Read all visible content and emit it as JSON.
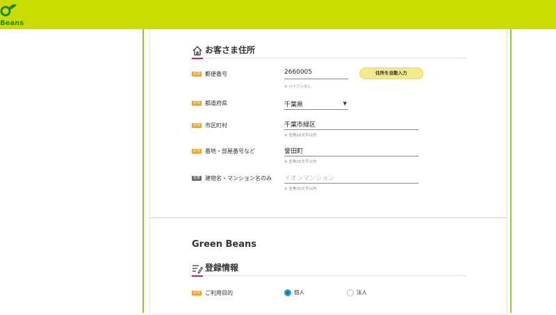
{
  "header": {
    "logo_text": "Beans",
    "brand_color": "#c8dc00"
  },
  "address_section": {
    "title": "お客さま住所",
    "icon": "house-icon",
    "required_badge": "必須",
    "optional_badge": "任意",
    "postal": {
      "label": "郵便番号",
      "value": "2660005",
      "note": "※ ハイフンなし",
      "autofill_button": "住所を自動入力"
    },
    "prefecture": {
      "label": "都道府県",
      "value": "千葉県"
    },
    "city": {
      "label": "市区町村",
      "value": "千葉市緑区",
      "note": "※ 全角20文字以内"
    },
    "street": {
      "label": "番地・部屋番号など",
      "value": "誉田町",
      "note": "※ 全角20文字以内"
    },
    "building": {
      "label": "建物名・マンション名のみ",
      "placeholder": "イオンマンション",
      "note": "※ 全角30文字以内"
    }
  },
  "registration_section": {
    "brand_title": "Green Beans",
    "title": "登録情報",
    "icon": "edit-list-icon",
    "purpose": {
      "label": "ご利用目的",
      "options": [
        "個人",
        "法人"
      ],
      "selected": "個人"
    }
  }
}
